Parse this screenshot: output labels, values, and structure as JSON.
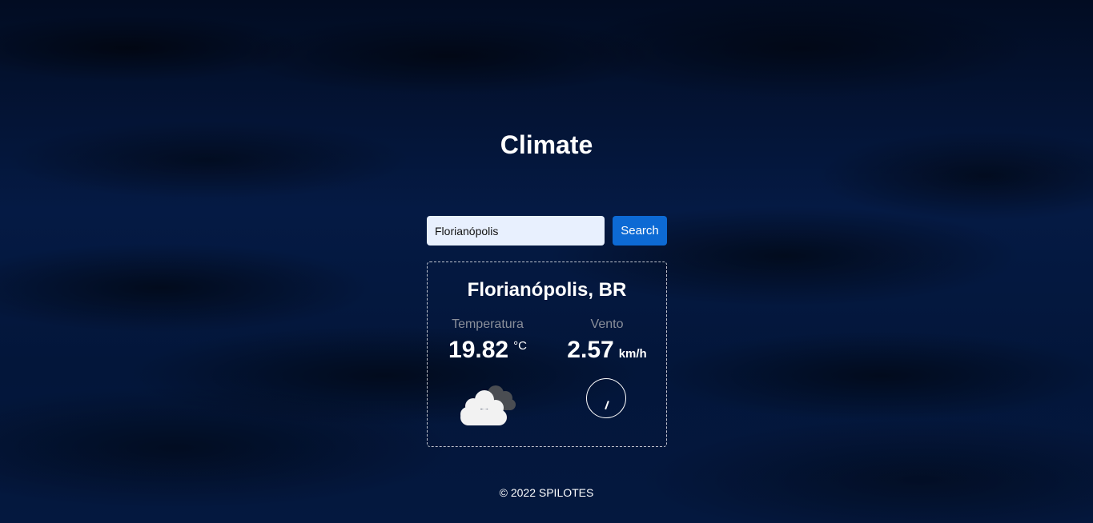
{
  "header": {
    "title": "Climate"
  },
  "search": {
    "value": "Florianópolis",
    "button_label": "Search"
  },
  "weather": {
    "location": "Florianópolis, BR",
    "temperature": {
      "label": "Temperatura",
      "value": "19.82",
      "unit": "°C"
    },
    "wind": {
      "label": "Vento",
      "value": "2.57",
      "unit": "km/h"
    },
    "condition_icon": "cloudy-icon",
    "wind_direction_icon": "wind-direction-icon"
  },
  "footer": {
    "text": "© 2022 SPILOTES"
  },
  "colors": {
    "background": "#03122e",
    "button": "#0d6ad4",
    "input_background": "#e8f0fe",
    "label": "#8a8f9a",
    "text": "#ffffff"
  }
}
